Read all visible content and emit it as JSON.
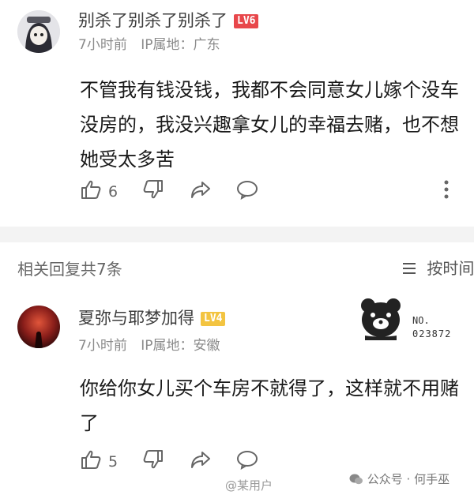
{
  "comment": {
    "username": "别杀了别杀了别杀了",
    "level": "LV6",
    "time": "7小时前",
    "ip_label": "IP属地：",
    "ip_location": "广东",
    "content": "不管我有钱没钱，我都不会同意女儿嫁个没车没房的，我没兴趣拿女儿的幸福去赌，也不想她受太多苦",
    "likes": "6"
  },
  "replies_header": {
    "title": "相关回复共7条",
    "sort_label": "按时间"
  },
  "reply": {
    "username": "夏弥与耶梦加得",
    "level": "LV4",
    "time": "7小时前",
    "ip_label": "IP属地：",
    "ip_location": "安徽",
    "content": "你给你女儿买个车房不就得了，这样就不用赌了",
    "likes": "5",
    "badge_no": "NO.",
    "badge_number": "023872"
  },
  "watermark": {
    "left": "@某用户",
    "right": "公众号 · 何手巫"
  },
  "colors": {
    "lv6": "#e8474b",
    "lv4": "#f3c441",
    "text": "#1a1a1a",
    "meta": "#8a8a8a"
  }
}
